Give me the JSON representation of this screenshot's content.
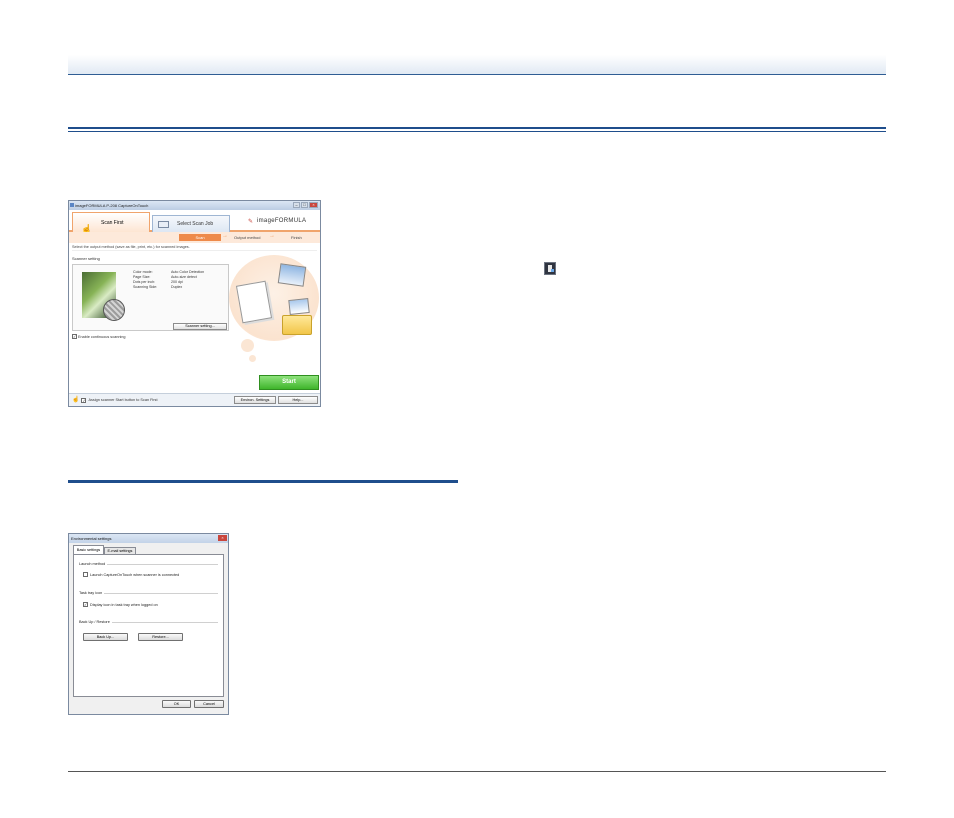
{
  "capture_on_touch": {
    "title": "imageFORMULA P-208 CaptureOnTouch",
    "tab_scan_first": "Scan First",
    "tab_select_job": "Select Scan Job",
    "logo": "imageFORMULA",
    "steps": [
      "Scan",
      "Output method",
      "Finish"
    ],
    "instruction": "Select the output method (save as file, print, etc.) for scanned images.",
    "scanner_setting_label": "Scanner setting",
    "settings": [
      {
        "key": "Color mode:",
        "value": "Auto Color Detection"
      },
      {
        "key": "Page Size:",
        "value": "Auto-size detect"
      },
      {
        "key": "Dots per inch:",
        "value": "200 dpi"
      },
      {
        "key": "Scanning Side:",
        "value": "Duplex"
      }
    ],
    "scanner_settings_button": "Scanner setting...",
    "continuous_scanning": "Enable continuous scanning",
    "start_button": "Start",
    "assign_label": "Assign scanner Start button to Scan First",
    "env_settings_button": "Environ. Settings",
    "help_button": "Help..."
  },
  "env_dialog": {
    "title": "Environmental settings",
    "tab_basic": "Basic settings",
    "tab_email": "E-mail settings",
    "launch_method_label": "Launch method",
    "launch_option": "Launch CaptureOnTouch when scanner is connected",
    "launch_checked": false,
    "task_tray_label": "Task tray icon",
    "task_tray_option": "Display icon in task tray when logged on",
    "task_tray_checked": true,
    "backup_label": "Back Up / Restore",
    "backup_button": "Back Up...",
    "restore_button": "Restore...",
    "ok_button": "OK",
    "cancel_button": "Cancel"
  },
  "icons": {
    "tray": "capture-on-touch-tray-icon"
  }
}
